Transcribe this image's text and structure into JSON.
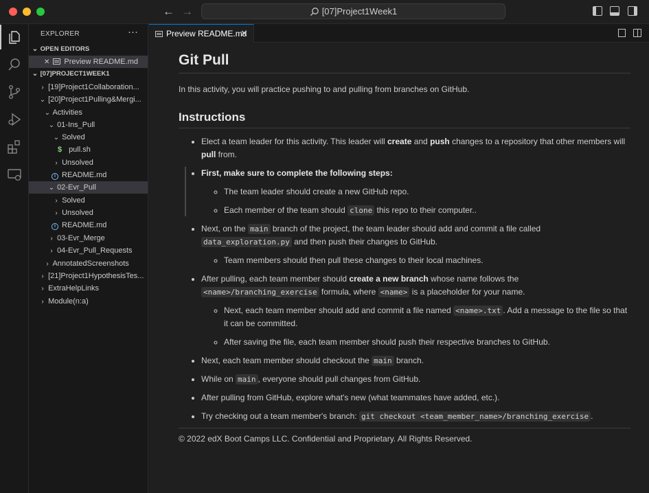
{
  "window": {
    "search_title": "[07]Project1Week1"
  },
  "sidebar": {
    "title": "EXPLORER",
    "more": "···",
    "open_editors_header": "OPEN EDITORS",
    "open_editor_item": "Preview README.md",
    "project_header": "[07]PROJECT1WEEK1",
    "tree": [
      "[19]Project1Collaboration...",
      "[20]Project1Pulling&Mergi...",
      "Activities",
      "01-Ins_Pull",
      "Solved",
      "pull.sh",
      "Unsolved",
      "README.md",
      "02-Evr_Pull",
      "Solved",
      "Unsolved",
      "README.md",
      "03-Evr_Merge",
      "04-Evr_Pull_Requests",
      "AnnotatedScreenshots",
      "[21]Project1HypothesisTes...",
      "ExtraHelpLinks",
      "Module(n:a)"
    ]
  },
  "tab": {
    "label": "Preview README.md",
    "close": "✕"
  },
  "doc": {
    "title": "Git Pull",
    "intro": "In this activity, you will practice pushing to and pulling from branches on GitHub.",
    "instructions_heading": "Instructions",
    "b1": {
      "t1": "Elect a team leader for this activity. This leader will ",
      "s1": "create",
      "t2": " and ",
      "s2": "push",
      "t3": " changes to a repository that other members will ",
      "s3": "pull",
      "t4": " from."
    },
    "b2": {
      "strong": "First, make sure to complete the following steps:"
    },
    "b2_sub1": "The team leader should create a new GitHub repo.",
    "b2_sub2": {
      "t1": "Each member of the team should ",
      "code": "clone",
      "t2": " this repo to their computer.."
    },
    "b3": {
      "t1": "Next, on the ",
      "code1": "main",
      "t2": " branch of the project, the team leader should add and commit a file called ",
      "code2": "data_exploration.py",
      "t3": " and then push their changes to GitHub."
    },
    "b3_sub1": "Team members should then pull these changes to their local machines.",
    "b4": {
      "t1": "After pulling, each team member should ",
      "strong": "create a new branch",
      "t2": " whose name follows the ",
      "code1": "<name>/branching_exercise",
      "t3": " formula, where ",
      "code2": "<name>",
      "t4": " is a placeholder for your name."
    },
    "b4_sub1": {
      "t1": "Next, each team member should add and commit a file named ",
      "code": "<name>.txt",
      "t2": ". Add a message to the file so that it can be committed."
    },
    "b4_sub2": "After saving the file, each team member should push their respective branches to GitHub.",
    "b5": {
      "t1": "Next, each team member should checkout the ",
      "code": "main",
      "t2": " branch."
    },
    "b6": {
      "t1": "While on ",
      "code": "main",
      "t2": ", everyone should pull changes from GitHub."
    },
    "b7": "After pulling from GitHub, explore what's new (what teammates have added, etc.).",
    "b8": {
      "t1": "Try checking out a team member's branch: ",
      "code": "git checkout <team_member_name>/branching_exercise",
      "t2": "."
    },
    "footer": "© 2022 edX Boot Camps LLC. Confidential and Proprietary. All Rights Reserved."
  }
}
